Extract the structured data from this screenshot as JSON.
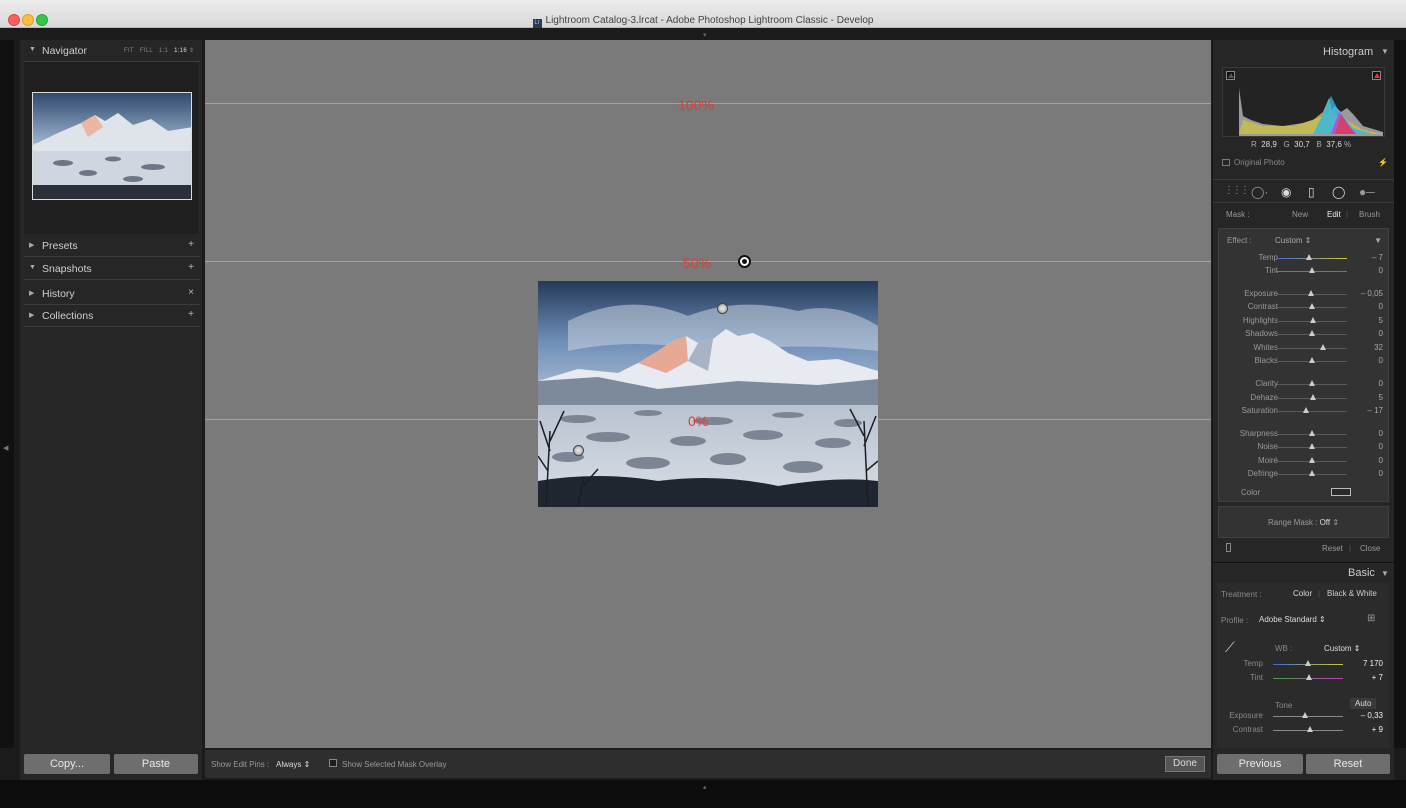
{
  "window": {
    "title": "Lightroom Catalog-3.lrcat - Adobe Photoshop Lightroom Classic - Develop",
    "app_icon_text": "Lr"
  },
  "left_panel": {
    "navigator": {
      "title": "Navigator",
      "zoom_options": [
        "FIT",
        "FILL",
        "1:1"
      ],
      "zoom_current": "1:16"
    },
    "sections": [
      {
        "label": "Presets",
        "action": "+"
      },
      {
        "label": "Snapshots",
        "action": "+"
      },
      {
        "label": "History",
        "action": "×"
      },
      {
        "label": "Collections",
        "action": "+"
      }
    ],
    "copy_label": "Copy...",
    "paste_label": "Paste"
  },
  "center": {
    "gradient_labels": {
      "top": "100%",
      "mid": "50%",
      "bottom": "0%"
    }
  },
  "toolbar": {
    "show_pins_label": "Show Edit Pins :",
    "show_pins_value": "Always",
    "overlay_label": "Show Selected Mask Overlay",
    "done_label": "Done"
  },
  "right_panel": {
    "histogram": {
      "title": "Histogram",
      "r_label": "R",
      "r": "28,9",
      "g_label": "G",
      "g": "30,7",
      "b_label": "B",
      "b": "37,6",
      "unit": "%",
      "original_photo": "Original Photo"
    },
    "mask": {
      "label": "Mask :",
      "new": "New",
      "edit": "Edit",
      "brush": "Brush"
    },
    "effect": {
      "label": "Effect :",
      "value": "Custom"
    },
    "mask_sliders": [
      {
        "name": "Temp",
        "value": "– 7",
        "pos": 0.45
      },
      {
        "name": "Tint",
        "value": "0",
        "pos": 0.5
      },
      {
        "name": "Exposure",
        "value": "– 0,05",
        "pos": 0.49
      },
      {
        "name": "Contrast",
        "value": "0",
        "pos": 0.5
      },
      {
        "name": "Highlights",
        "value": "5",
        "pos": 0.52
      },
      {
        "name": "Shadows",
        "value": "0",
        "pos": 0.5
      },
      {
        "name": "Whites",
        "value": "32",
        "pos": 0.66
      },
      {
        "name": "Blacks",
        "value": "0",
        "pos": 0.5
      },
      {
        "name": "Clarity",
        "value": "0",
        "pos": 0.5
      },
      {
        "name": "Dehaze",
        "value": "5",
        "pos": 0.52
      },
      {
        "name": "Saturation",
        "value": "– 17",
        "pos": 0.42
      },
      {
        "name": "Sharpness",
        "value": "0",
        "pos": 0.5
      },
      {
        "name": "Noise",
        "value": "0",
        "pos": 0.5
      },
      {
        "name": "Moiré",
        "value": "0",
        "pos": 0.5
      },
      {
        "name": "Defringe",
        "value": "0",
        "pos": 0.5
      }
    ],
    "color_label": "Color",
    "range_mask": {
      "label": "Range Mask :",
      "value": "Off"
    },
    "mask_reset": "Reset",
    "mask_close": "Close",
    "basic": {
      "title": "Basic",
      "treatment_label": "Treatment :",
      "treatment_color": "Color",
      "treatment_bw": "Black & White",
      "profile_label": "Profile :",
      "profile_value": "Adobe Standard",
      "wb_label": "WB :",
      "wb_value": "Custom",
      "sliders": [
        {
          "name": "Temp",
          "value": "7 170",
          "pos": 0.5
        },
        {
          "name": "Tint",
          "value": "+ 7",
          "pos": 0.52
        }
      ],
      "tone_label": "Tone",
      "auto_label": "Auto",
      "tone_sliders": [
        {
          "name": "Exposure",
          "value": "– 0,33",
          "pos": 0.45
        },
        {
          "name": "Contrast",
          "value": "+ 9",
          "pos": 0.53
        }
      ]
    },
    "previous_label": "Previous",
    "reset_label": "Reset"
  },
  "colors": {
    "gradient_label": "#e53935",
    "canvas": "#7a7a7a",
    "panel": "#262626"
  }
}
